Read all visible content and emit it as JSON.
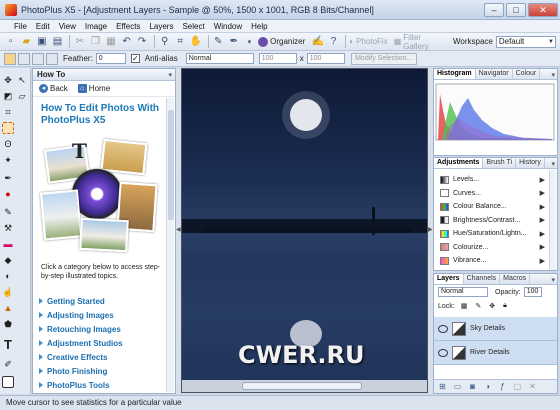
{
  "window": {
    "title": "PhotoPlus X5 - [Adjustment Layers - Sample @ 50%, 1500 x 1001, RGB 8 Bits/Channel]",
    "min": "–",
    "max": "□",
    "close": "✕"
  },
  "menu": [
    "File",
    "Edit",
    "View",
    "Image",
    "Effects",
    "Layers",
    "Select",
    "Window",
    "Help"
  ],
  "toolbar": {
    "organizer": "Organizer",
    "photofix": "PhotoFix",
    "filter_gallery": "Filter Gallery",
    "workspace_label": "Workspace",
    "workspace_value": "Default"
  },
  "context_bar": {
    "feather_label": "Feather:",
    "feather_value": "0",
    "antialias_label": "Anti-alias",
    "antialias_checked": "✓",
    "blend_mode": "Normal",
    "width_value": "100",
    "x_label": "x",
    "height_value": "100",
    "modify": "Modify Selection..."
  },
  "howto": {
    "tab": "How To",
    "back": "Back",
    "home": "Home",
    "title": "How To Edit Photos With PhotoPlus X5",
    "description": "Click a category below to access step-by-step illustrated topics.",
    "links": [
      "Getting Started",
      "Adjusting Images",
      "Retouching Images",
      "Adjustment Studios",
      "Creative Effects",
      "Photo Finishing",
      "PhotoPlus Tools"
    ]
  },
  "canvas": {
    "watermark": "CWER.RU"
  },
  "histogram_panel": {
    "tabs": [
      "Histogram",
      "Navigator",
      "Colour"
    ]
  },
  "adjustments_panel": {
    "tabs": [
      "Adjustments",
      "Brush Ti",
      "History"
    ],
    "items": [
      "Levels...",
      "Curves...",
      "Colour Balance...",
      "Brightness/Contrast...",
      "Hue/Saturation/Lightn...",
      "Colourize...",
      "Vibrance..."
    ]
  },
  "layers_panel": {
    "tabs": [
      "Layers",
      "Channels",
      "Macros"
    ],
    "blend": "Normal",
    "opacity_label": "Opacity:",
    "opacity_value": "100",
    "lock_label": "Lock:",
    "layers": [
      "Sky Details",
      "River Details"
    ]
  },
  "status": {
    "text": "Move cursor to see statistics for a particular value"
  },
  "colors": {
    "accent": "#1b7ab6",
    "sky_top": "#0e1a36",
    "panel_bg": "#cfd8e6"
  }
}
